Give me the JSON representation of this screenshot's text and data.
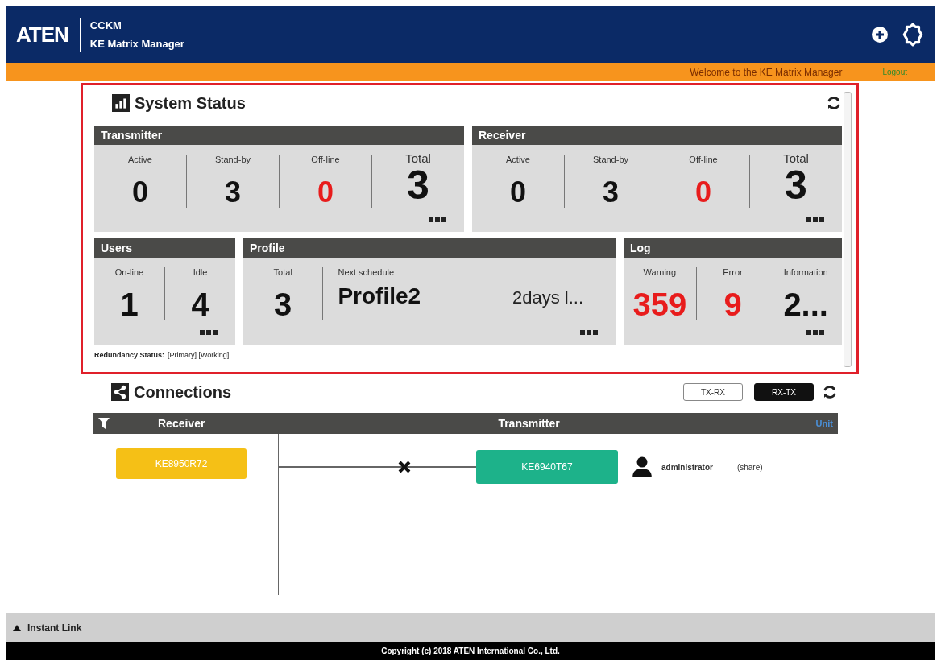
{
  "header": {
    "logo": "ATEN",
    "product": "CCKM",
    "app": "KE Matrix Manager"
  },
  "welcome": {
    "text": "Welcome to the KE Matrix Manager",
    "logout": "Logout"
  },
  "system_status": {
    "title": "System Status",
    "groups": [
      {
        "title": "Transmitter",
        "stats": [
          {
            "label": "Active",
            "value": "0",
            "alert": false
          },
          {
            "label": "Stand-by",
            "value": "3",
            "alert": false
          },
          {
            "label": "Off-line",
            "value": "0",
            "alert": true
          },
          {
            "label": "Total",
            "value": "3",
            "alert": false,
            "kind": "total"
          }
        ]
      },
      {
        "title": "Receiver",
        "stats": [
          {
            "label": "Active",
            "value": "0",
            "alert": false
          },
          {
            "label": "Stand-by",
            "value": "3",
            "alert": false
          },
          {
            "label": "Off-line",
            "value": "0",
            "alert": true
          },
          {
            "label": "Total",
            "value": "3",
            "alert": false,
            "kind": "total"
          }
        ]
      },
      {
        "title": "Users",
        "stats": [
          {
            "label": "On-line",
            "value": "1",
            "alert": false
          },
          {
            "label": "Idle",
            "value": "4",
            "alert": false
          }
        ]
      },
      {
        "title": "Profile",
        "stats": [
          {
            "label": "Total",
            "value": "3",
            "alert": false
          },
          {
            "label": "Next schedule",
            "value": "Profile2",
            "detail": "2days l...",
            "kind": "schedule"
          }
        ]
      },
      {
        "title": "Log",
        "stats": [
          {
            "label": "Warning",
            "value": "359",
            "alert": true
          },
          {
            "label": "Error",
            "value": "9",
            "alert": true
          },
          {
            "label": "Information",
            "value": "2...",
            "alert": false
          }
        ]
      }
    ],
    "redundancy": {
      "label": "Redundancy Status:",
      "value": "[Primary] [Working]"
    }
  },
  "connections": {
    "title": "Connections",
    "modes": [
      {
        "label": "TX-RX",
        "selected": false
      },
      {
        "label": "RX-TX",
        "selected": true
      }
    ],
    "columns": [
      "Receiver",
      "Transmitter",
      "Unit"
    ],
    "rows": [
      {
        "receiver": "KE8950R72",
        "transmitter": "KE6940T67",
        "user": "administrator",
        "access": "(share)"
      }
    ]
  },
  "instant_link": "Instant Link",
  "footer": "Copyright (c) 2018 ATEN International Co., Ltd."
}
